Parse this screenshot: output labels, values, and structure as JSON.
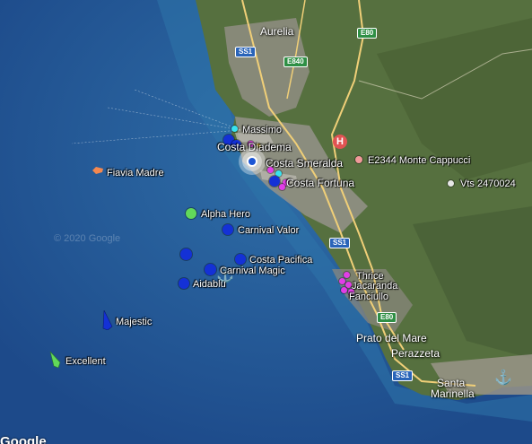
{
  "map": {
    "watermark": "© 2020 Google",
    "google_logo": "Google",
    "colors": {
      "sea_deep": "#1d4a8a",
      "sea_shallow": "#2c6aa4",
      "land": "#5a7046",
      "urban": "#8d8f86",
      "road": "#f2d07a",
      "vessel_blue": "#1431d6",
      "vessel_magenta": "#e23ee7",
      "vessel_green": "#62d85a",
      "vessel_cyan": "#38e3f0",
      "vessel_orange": "#f4884f",
      "station_pink": "#f19a9a",
      "station_white": "#e8e8e8"
    }
  },
  "places": {
    "aurelia": "Aurelia",
    "prato_del_mare": "Prato del Mare",
    "perazzeta": "Perazzeta",
    "santa": "Santa",
    "marinella": "Marinella"
  },
  "road_shields": {
    "ss1_a": "SS1",
    "e80_a": "E80",
    "e840": "E840",
    "ss1_b": "SS1",
    "e80_b": "E80",
    "ss1_c": "SS1"
  },
  "vessels": {
    "massimo": "Massimo",
    "costa_diadema": "Costa Diadema",
    "costa_smeralda": "Costa Smeralda",
    "costa_fortuna": "Costa Fortuna",
    "fiavia_madre": "Fiavia Madre",
    "alpha_hero": "Alpha Hero",
    "carnival_valor": "Carnival Valor",
    "costa_pacifica": "Costa Pacifica",
    "carnival_magic": "Carnival Magic",
    "aidablu": "Aidablu",
    "majestic": "Majestic",
    "excellent": "Excellent",
    "thrice": "Thrice",
    "jacaranda": "Jacaranda",
    "fanciullo": "Fanciullo"
  },
  "stations": {
    "monte_cappucci": "E2344 Monte Cappucci",
    "vts": "Vts 2470024"
  },
  "icons": {
    "hospital": "H",
    "anchor": "⚓"
  }
}
